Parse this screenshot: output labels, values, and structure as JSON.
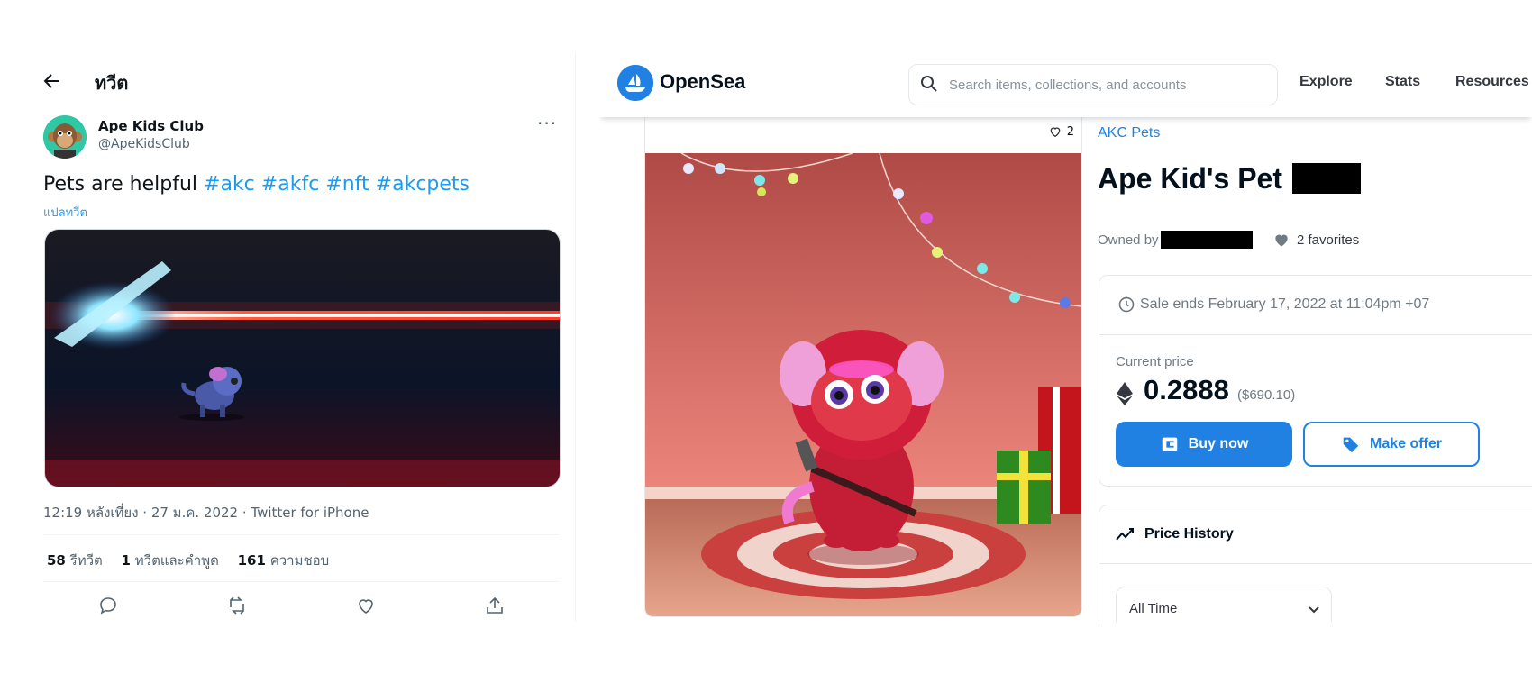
{
  "twitter": {
    "header_title": "ทวีต",
    "author_name": "Ape Kids Club",
    "author_handle": "@ApeKidsClub",
    "tweet_text": "Pets are helpful",
    "hashtags": [
      "#akc",
      "#akfc",
      "#nft",
      "#akcpets"
    ],
    "translate_label": "แปลทวีต",
    "meta": "12:19 หลังเที่ยง · 27 ม.ค. 2022 · Twitter for iPhone",
    "stats": [
      {
        "count": "58",
        "label": "รีทวีต"
      },
      {
        "count": "1",
        "label": "ทวีตและคำพูด"
      },
      {
        "count": "161",
        "label": "ความชอบ"
      }
    ],
    "actions": [
      "reply-icon",
      "retweet-icon",
      "like-icon",
      "share-icon"
    ],
    "colors": {
      "link": "#1d9bf0",
      "text": "#0f1419",
      "muted": "#536471"
    }
  },
  "opensea": {
    "brand": "OpenSea",
    "search_placeholder": "Search items, collections, and accounts",
    "nav": [
      "Explore",
      "Stats",
      "Resources"
    ],
    "card_favorites": "2",
    "collection": "AKC Pets",
    "item_title": "Ape Kid's Pet",
    "owned_by_label": "Owned by",
    "favorites_label": "2 favorites",
    "sale_ends": "Sale ends February 17, 2022 at 11:04pm +07",
    "current_price_label": "Current price",
    "price": "0.2888",
    "price_usd": "($690.10)",
    "buy_now_label": "Buy now",
    "make_offer_label": "Make offer",
    "price_history_label": "Price History",
    "time_filter": "All Time",
    "colors": {
      "brand": "#2081e2",
      "text": "#04111d",
      "muted": "#707a83"
    }
  }
}
